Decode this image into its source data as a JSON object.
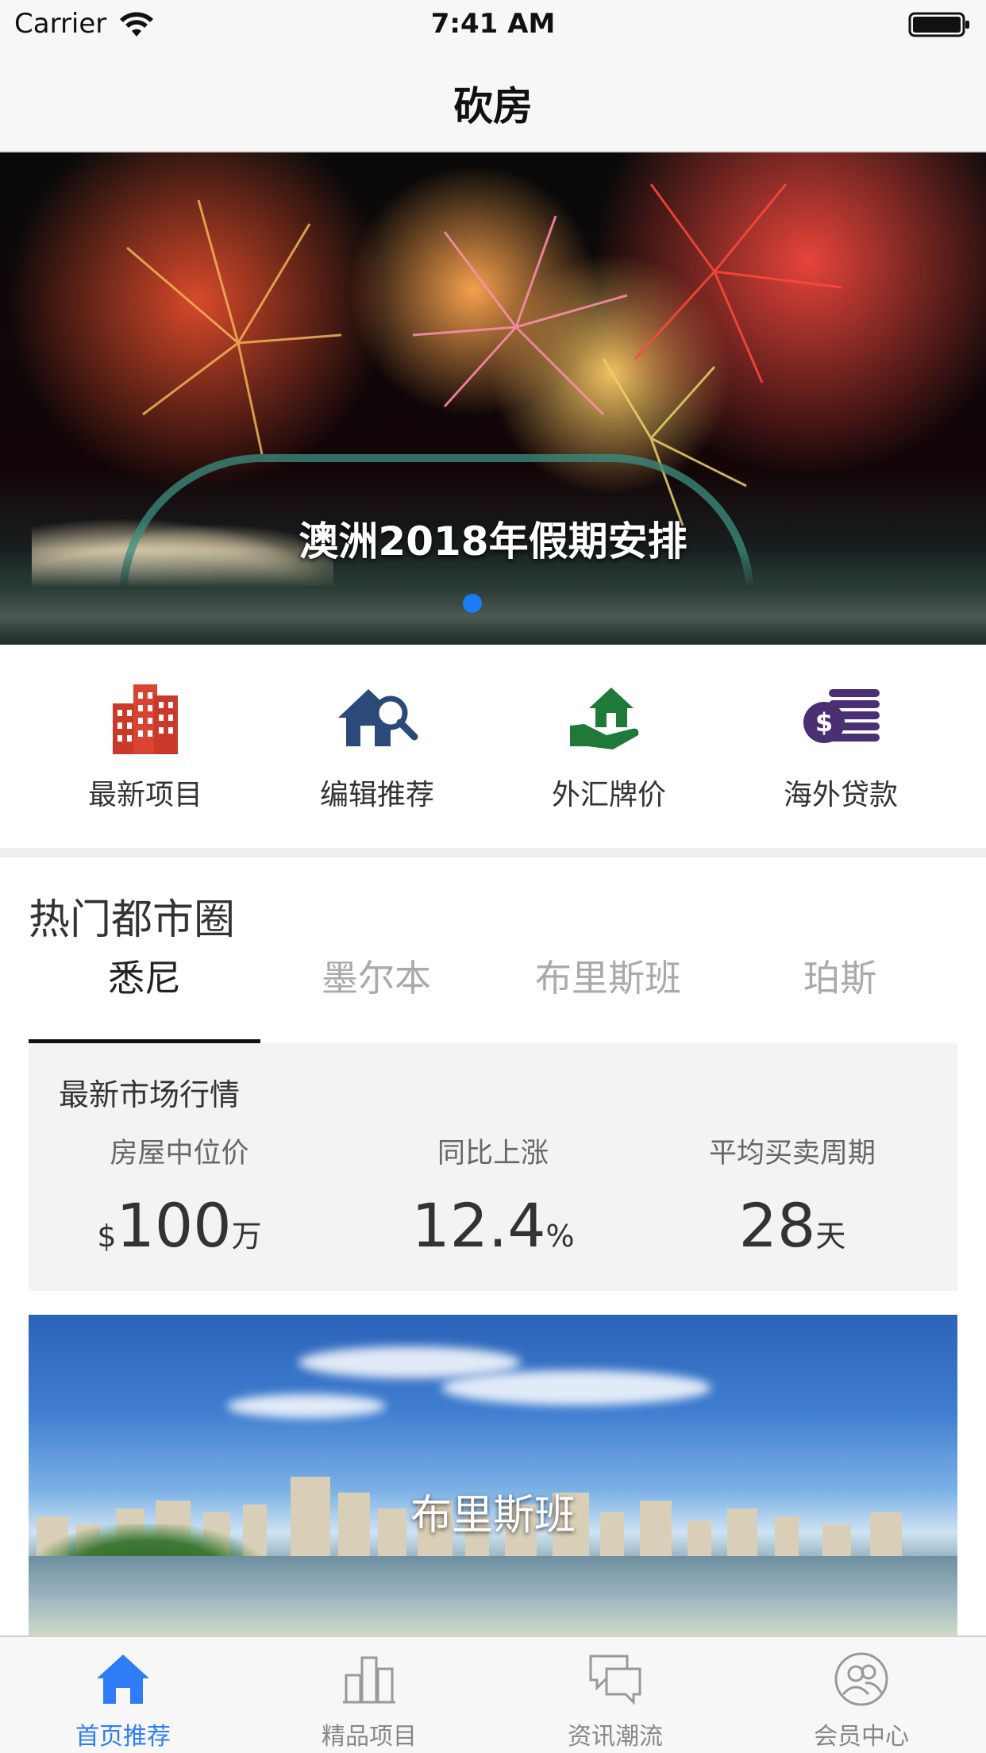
{
  "status_bar": {
    "carrier": "Carrier",
    "time": "7:41 AM"
  },
  "nav": {
    "title": "砍房"
  },
  "banner": {
    "caption": "澳洲2018年假期安排",
    "active_index": 0
  },
  "quick_actions": [
    {
      "label": "最新项目",
      "icon": "building-icon",
      "color": "#c93a2a"
    },
    {
      "label": "编辑推荐",
      "icon": "house-search-icon",
      "color": "#2b4a7a"
    },
    {
      "label": "外汇牌价",
      "icon": "hand-house-icon",
      "color": "#1f7a3a"
    },
    {
      "label": "海外贷款",
      "icon": "coins-dollar-icon",
      "color": "#4a2f72"
    }
  ],
  "hot_cities": {
    "title": "热门都市圈",
    "tabs": [
      "悉尼",
      "墨尔本",
      "布里斯班",
      "珀斯"
    ],
    "active_tab": 0
  },
  "market": {
    "title": "最新市场行情",
    "stats": [
      {
        "label": "房屋中位价",
        "prefix": "$",
        "value": "100",
        "suffix": "万"
      },
      {
        "label": "同比上涨",
        "prefix": "",
        "value": "12.4",
        "suffix": "%"
      },
      {
        "label": "平均买卖周期",
        "prefix": "",
        "value": "28",
        "suffix": "天"
      }
    ]
  },
  "city_card": {
    "caption": "布里斯班"
  },
  "tab_bar": {
    "items": [
      {
        "label": "首页推荐",
        "icon": "home-icon"
      },
      {
        "label": "精品项目",
        "icon": "buildings-icon"
      },
      {
        "label": "资讯潮流",
        "icon": "chat-bubbles-icon"
      },
      {
        "label": "会员中心",
        "icon": "member-icon"
      }
    ],
    "active_index": 0,
    "active_color": "#2e7cf6"
  }
}
